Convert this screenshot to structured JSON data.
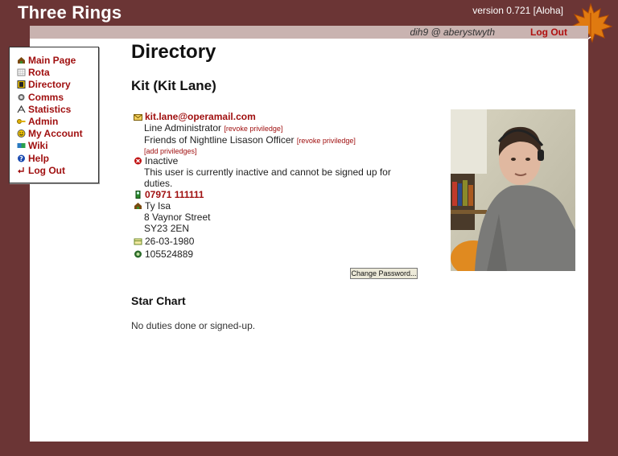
{
  "header": {
    "brand": "Three Rings",
    "version": "version 0.721 [Aloha]",
    "user": "dih9 @ aberystwyth",
    "logout": "Log Out"
  },
  "nav": {
    "items": [
      {
        "label": "Main Page",
        "icon": "house-icon"
      },
      {
        "label": "Rota",
        "icon": "calendar-icon"
      },
      {
        "label": "Directory",
        "icon": "book-icon"
      },
      {
        "label": "Comms",
        "icon": "comms-icon"
      },
      {
        "label": "Statistics",
        "icon": "chart-icon"
      },
      {
        "label": "Admin",
        "icon": "key-icon"
      },
      {
        "label": "My Account",
        "icon": "smiley-icon"
      },
      {
        "label": "Wiki",
        "icon": "wiki-icon"
      },
      {
        "label": "Help",
        "icon": "help-icon"
      },
      {
        "label": "Log Out",
        "icon": "logout-arrow-icon"
      }
    ]
  },
  "page": {
    "title": "Directory",
    "person": "Kit (Kit Lane)",
    "email": "kit.lane@operamail.com",
    "roles": [
      {
        "name": "Line Administrator",
        "action": "[revoke priviledge]"
      },
      {
        "name": "Friends of Nightline Lisason Officer",
        "action": "[revoke priviledge]"
      }
    ],
    "add_priv": "[add priviledges]",
    "status": "Inactive",
    "status_note": "This user is currently inactive and cannot be signed up for duties.",
    "phone": "07971 111111",
    "address": [
      "Ty Isa",
      "8 Vaynor Street",
      "SY23 2EN"
    ],
    "dob": "26-03-1980",
    "id_number": "105524889",
    "change_password": "Change Password...",
    "star_chart_title": "Star Chart",
    "star_chart_text": "No duties done or signed-up."
  },
  "colors": {
    "frame": "#6b3535",
    "link": "#a01010",
    "userbar": "#c9b3b0"
  }
}
